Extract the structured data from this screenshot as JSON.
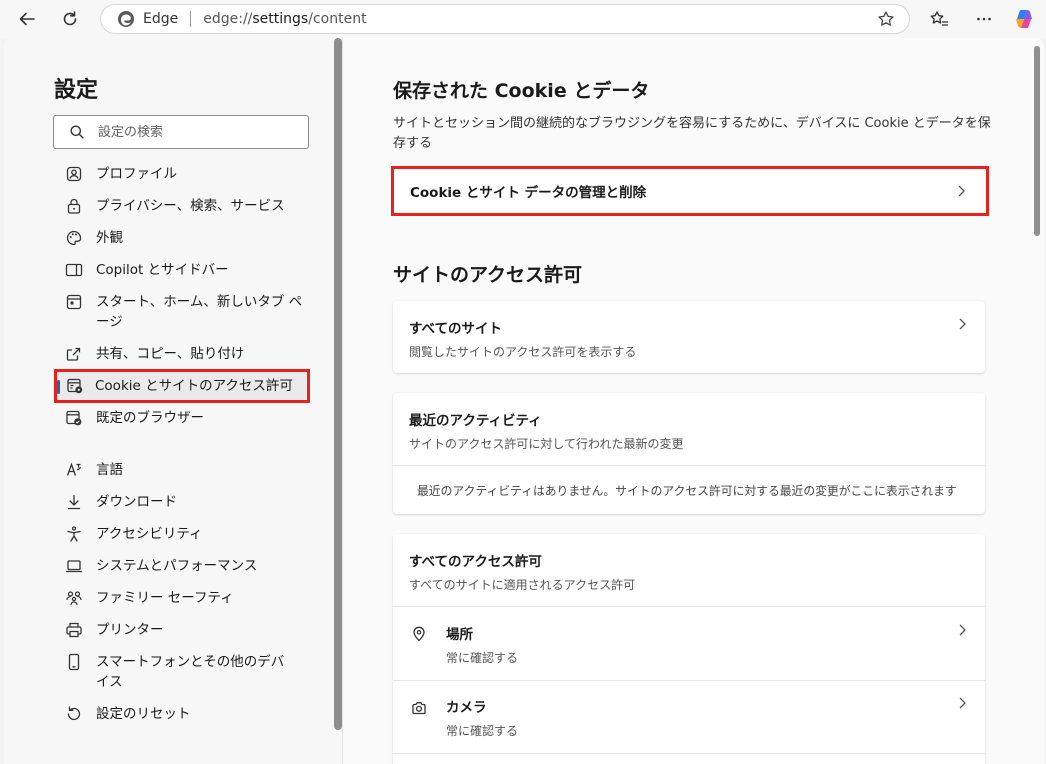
{
  "browser": {
    "site_name": "Edge",
    "url_prefix": "edge://",
    "url_host": "settings",
    "url_path": "/content"
  },
  "sidebar": {
    "title": "設定",
    "search_placeholder": "設定の検索",
    "items": [
      {
        "label": "プロファイル",
        "icon": "profile-icon"
      },
      {
        "label": "プライバシー、検索、サービス",
        "icon": "lock-icon"
      },
      {
        "label": "外観",
        "icon": "palette-icon"
      },
      {
        "label": "Copilot とサイドバー",
        "icon": "sidebar-icon"
      },
      {
        "label": "スタート、ホーム、新しいタブ ページ",
        "icon": "home-icon"
      },
      {
        "label": "共有、コピー、貼り付け",
        "icon": "share-icon"
      },
      {
        "label": "Cookie とサイトのアクセス許可",
        "icon": "cookie-permission-icon",
        "active": true
      },
      {
        "label": "既定のブラウザー",
        "icon": "browser-icon"
      },
      {
        "label": "言語",
        "icon": "language-icon"
      },
      {
        "label": "ダウンロード",
        "icon": "download-icon"
      },
      {
        "label": "アクセシビリティ",
        "icon": "accessibility-icon"
      },
      {
        "label": "システムとパフォーマンス",
        "icon": "system-icon"
      },
      {
        "label": "ファミリー セーフティ",
        "icon": "family-icon"
      },
      {
        "label": "プリンター",
        "icon": "printer-icon"
      },
      {
        "label": "スマートフォンとその他のデバイス",
        "icon": "phone-icon"
      },
      {
        "label": "設定のリセット",
        "icon": "reset-icon"
      }
    ]
  },
  "main": {
    "cookies_section": {
      "heading": "保存された Cookie とデータ",
      "description": "サイトとセッション間の継続的なブラウジングを容易にするために、デバイスに Cookie とデータを保存する",
      "manage_label": "Cookie とサイト データの管理と削除"
    },
    "permissions_section": {
      "heading": "サイトのアクセス許可",
      "all_sites": {
        "title": "すべてのサイト",
        "subtitle": "閲覧したサイトのアクセス許可を表示する"
      },
      "recent_activity": {
        "title": "最近のアクティビティ",
        "subtitle": "サイトのアクセス許可に対して行われた最新の変更",
        "empty_message": "最近のアクティビティはありません。サイトのアクセス許可に対する最近の変更がここに表示されます"
      },
      "all_permissions": {
        "title": "すべてのアクセス許可",
        "subtitle": "すべてのサイトに適用されるアクセス許可",
        "items": [
          {
            "title": "場所",
            "subtitle": "常に確認する",
            "icon": "location-icon"
          },
          {
            "title": "カメラ",
            "subtitle": "常に確認する",
            "icon": "camera-icon"
          }
        ]
      }
    }
  },
  "colors": {
    "highlight": "#e8211a",
    "accent": "#0f6cbd"
  }
}
